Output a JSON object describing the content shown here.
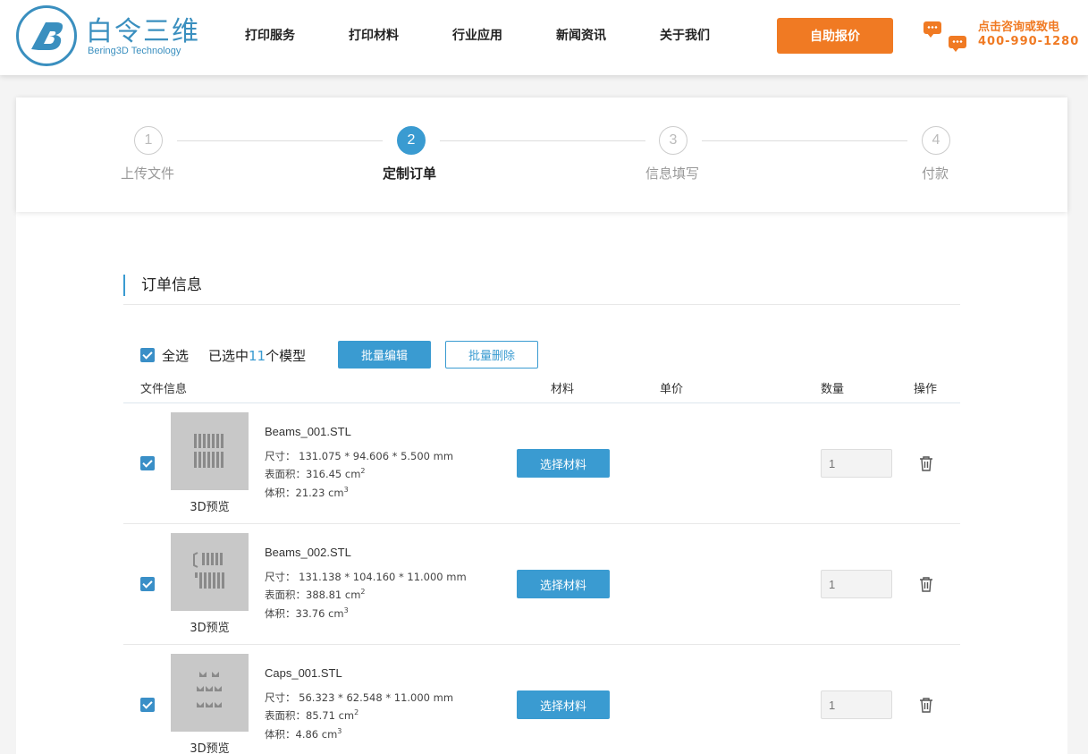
{
  "brand": {
    "name_cn": "白令三维",
    "name_en": "Bering3D Technology",
    "color": "#3a8fbf"
  },
  "nav": {
    "items": [
      {
        "label": "打印服务"
      },
      {
        "label": "打印材料"
      },
      {
        "label": "行业应用"
      },
      {
        "label": "新闻资讯"
      },
      {
        "label": "关于我们"
      }
    ],
    "quote_button": "自助报价",
    "contact_text": "点击咨询或致电",
    "contact_phone": "400-990-1280",
    "accent": "#f07a23"
  },
  "steps": [
    {
      "number": "1",
      "label": "上传文件"
    },
    {
      "number": "2",
      "label": "定制订单"
    },
    {
      "number": "3",
      "label": "信息填写"
    },
    {
      "number": "4",
      "label": "付款"
    }
  ],
  "order": {
    "section_title": "订单信息",
    "select_all_label": "全选",
    "selected_prefix": "已选中",
    "selected_count": "11",
    "selected_suffix": "个模型",
    "batch_edit": "批量编辑",
    "batch_delete": "批量删除",
    "columns": {
      "file_info": "文件信息",
      "material": "材料",
      "unit_price": "单价",
      "quantity": "数量",
      "actions": "操作"
    },
    "items": [
      {
        "filename": "Beams_001.STL",
        "size_label": "尺寸：",
        "size": "131.075 * 94.606 * 5.500 mm",
        "area_label": "表面积：",
        "area": "316.45 cm",
        "volume_label": "体积：",
        "volume": "21.23 cm",
        "preview_label": "3D预览",
        "material_button": "选择材料",
        "quantity_placeholder": "1"
      },
      {
        "filename": "Beams_002.STL",
        "size_label": "尺寸：",
        "size": "131.138 * 104.160 * 11.000 mm",
        "area_label": "表面积：",
        "area": "388.81 cm",
        "volume_label": "体积：",
        "volume": "33.76 cm",
        "preview_label": "3D预览",
        "material_button": "选择材料",
        "quantity_placeholder": "1"
      },
      {
        "filename": "Caps_001.STL",
        "size_label": "尺寸：",
        "size": "56.323 * 62.548 * 11.000 mm",
        "area_label": "表面积：",
        "area": "85.71 cm",
        "volume_label": "体积：",
        "volume": "4.86 cm",
        "preview_label": "3D预览",
        "material_button": "选择材料",
        "quantity_placeholder": "1"
      }
    ],
    "unit_superscripts": {
      "area": "2",
      "volume": "3"
    },
    "primary_color": "#3a9bd1"
  }
}
